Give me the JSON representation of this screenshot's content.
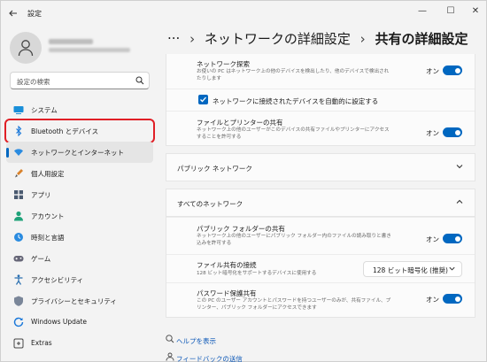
{
  "window": {
    "title": "設定",
    "minimize": "—",
    "maximize": "☐",
    "close": "✕"
  },
  "profile": {
    "name": "富士 ○○○ 様",
    "email": "fujitsu-○○○@outlook.jp"
  },
  "search": {
    "placeholder": "設定の検索"
  },
  "nav": {
    "items": [
      {
        "label": "システム",
        "icon": "monitor-icon"
      },
      {
        "label": "Bluetooth とデバイス",
        "icon": "bluetooth-icon"
      },
      {
        "label": "ネットワークとインターネット",
        "icon": "wifi-icon"
      },
      {
        "label": "個人用設定",
        "icon": "brush-icon"
      },
      {
        "label": "アプリ",
        "icon": "apps-icon"
      },
      {
        "label": "アカウント",
        "icon": "account-icon"
      },
      {
        "label": "時刻と言語",
        "icon": "globe-clock-icon"
      },
      {
        "label": "ゲーム",
        "icon": "gamepad-icon"
      },
      {
        "label": "アクセシビリティ",
        "icon": "accessibility-icon"
      },
      {
        "label": "プライバシーとセキュリティ",
        "icon": "shield-icon"
      },
      {
        "label": "Windows Update",
        "icon": "update-icon"
      },
      {
        "label": "Extras",
        "icon": "extras-icon"
      }
    ]
  },
  "breadcrumb": {
    "ellipsis": "···",
    "sep": "›",
    "parent": "ネットワークの詳細設定",
    "current": "共有の詳細設定"
  },
  "private_section": {
    "network_discovery": {
      "title": "ネットワーク探索",
      "desc": "お使いの PC はネットワーク上の他のデバイスを検出したり、他のデバイスで検出されたりします",
      "state": "オン"
    },
    "auto_setup": {
      "label": "ネットワークに接続されたデバイスを自動的に設定する"
    },
    "file_printer_sharing": {
      "title": "ファイルとプリンターの共有",
      "desc": "ネットワーク上の他のユーザーがこのデバイスの共有ファイルやプリンターにアクセスすることを許可する",
      "state": "オン"
    }
  },
  "public_network": {
    "title": "パブリック ネットワーク"
  },
  "all_networks": {
    "title": "すべてのネットワーク",
    "public_folder_sharing": {
      "title": "パブリック フォルダーの共有",
      "desc": "ネットワーク上の他のユーザーにパブリック フォルダー内のファイルの読み取りと書き込みを許可する",
      "state": "オン"
    },
    "file_sharing_connections": {
      "title": "ファイル共有の接続",
      "desc": "128 ビット暗号化をサポートするデバイスに使用する",
      "value": "128 ビット暗号化 (推奨)"
    },
    "password_protected_sharing": {
      "title": "パスワード保護共有",
      "desc": "この PC のユーザー アカウントとパスワードを持つユーザーのみが、共有ファイル、プリンター、パブリック フォルダーにアクセスできます",
      "state": "オン"
    }
  },
  "links": {
    "help": "ヘルプを表示",
    "feedback": "フィードバックの送信"
  },
  "colors": {
    "accent": "#0067c0",
    "highlight_box": "#e01f26"
  }
}
